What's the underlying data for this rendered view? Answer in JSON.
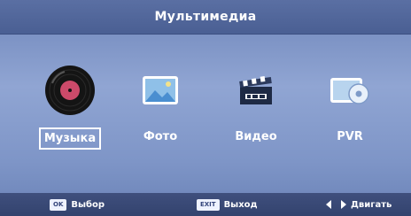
{
  "header": {
    "title": "Мультимедиа"
  },
  "menu": {
    "selected_index": 0,
    "items": [
      {
        "label": "Музыка",
        "icon": "vinyl-record-icon",
        "selected": true
      },
      {
        "label": "Фото",
        "icon": "photo-icon",
        "selected": false
      },
      {
        "label": "Видео",
        "icon": "clapperboard-icon",
        "selected": false
      },
      {
        "label": "PVR",
        "icon": "pvr-disc-icon",
        "selected": false
      }
    ]
  },
  "footer": {
    "ok_key": "OK",
    "ok_label": "Выбор",
    "exit_key": "EXIT",
    "exit_label": "Выход",
    "move_label": "Двигать"
  },
  "colors": {
    "background": "#8ba0d0",
    "title_bar": "#4f649a",
    "footer_bar": "#3a4a77",
    "text": "#ffffff"
  }
}
